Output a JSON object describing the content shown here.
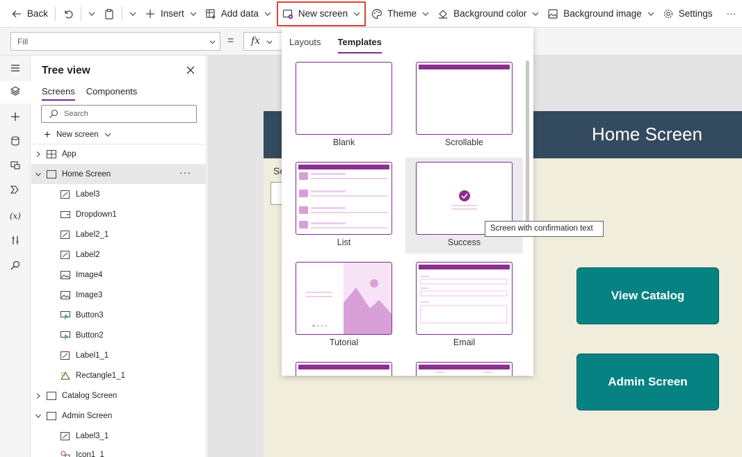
{
  "toolbar": {
    "back_label": "Back",
    "insert_label": "Insert",
    "add_data_label": "Add data",
    "new_screen_label": "New screen",
    "theme_label": "Theme",
    "background_color_label": "Background color",
    "background_image_label": "Background image",
    "settings_label": "Settings",
    "more_label": "···"
  },
  "formula_bar": {
    "property_value": "Fill",
    "equals": "=",
    "fx": "fx"
  },
  "tree_view": {
    "title": "Tree view",
    "tabs": [
      "Screens",
      "Components"
    ],
    "search_placeholder": "Search",
    "new_screen_label": "New screen",
    "items": [
      {
        "label": "App",
        "icon": "app-icon"
      },
      {
        "label": "Home Screen",
        "icon": "screen-icon",
        "more": "···"
      },
      {
        "label": "Label3",
        "icon": "label-icon"
      },
      {
        "label": "Dropdown1",
        "icon": "dropdown-icon"
      },
      {
        "label": "Label2_1",
        "icon": "label-icon"
      },
      {
        "label": "Label2",
        "icon": "label-icon"
      },
      {
        "label": "Image4",
        "icon": "image-icon"
      },
      {
        "label": "Image3",
        "icon": "image-icon"
      },
      {
        "label": "Button3",
        "icon": "button-icon"
      },
      {
        "label": "Button2",
        "icon": "button-icon"
      },
      {
        "label": "Label1_1",
        "icon": "label-icon"
      },
      {
        "label": "Rectangle1_1",
        "icon": "shape-icon"
      },
      {
        "label": "Catalog Screen",
        "icon": "screen-icon"
      },
      {
        "label": "Admin Screen",
        "icon": "screen-icon"
      },
      {
        "label": "Label3_1",
        "icon": "label-icon"
      },
      {
        "label": "Icon1_1",
        "icon": "icons-icon"
      }
    ]
  },
  "canvas": {
    "screen_title": "Home Screen",
    "partial_label": "Sc",
    "view_catalog_label": "View Catalog",
    "admin_screen_label": "Admin Screen",
    "colors": {
      "header": "#344a5e",
      "body": "#f1eddc",
      "button": "#068283"
    }
  },
  "new_screen_menu": {
    "tabs": [
      "Layouts",
      "Templates"
    ],
    "active_tab": "Templates",
    "templates": [
      "Blank",
      "Scrollable",
      "List",
      "Success",
      "Tutorial",
      "Email"
    ],
    "tooltip": "Screen with confirmation text",
    "accent": "#8d2f8e"
  }
}
